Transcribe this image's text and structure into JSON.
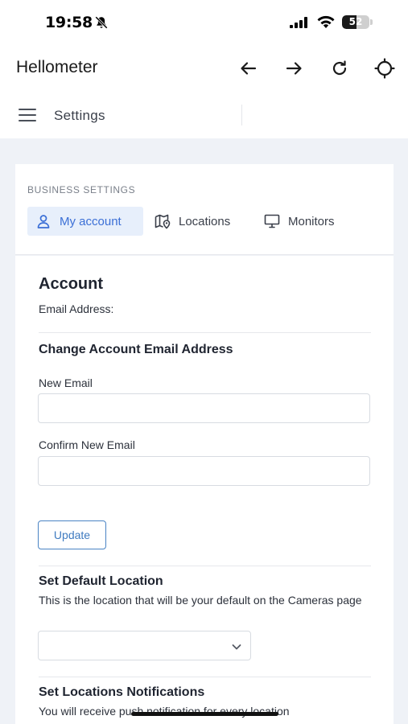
{
  "status_bar": {
    "time": "19:58",
    "battery_percent": "52",
    "battery_level": 52
  },
  "app_bar": {
    "title": "Hellometer",
    "icons": [
      "arrow-left-icon",
      "arrow-right-icon",
      "reload-icon",
      "crosshair-icon"
    ]
  },
  "settings_bar": {
    "title": "Settings",
    "menu_icon": "hamburger-menu-icon"
  },
  "business_settings": {
    "caption": "BUSINESS SETTINGS",
    "tabs": [
      {
        "label": "My account",
        "icon": "user-icon",
        "active": true
      },
      {
        "label": "Locations",
        "icon": "map-pin-icon",
        "active": false
      },
      {
        "label": "Monitors",
        "icon": "monitor-icon",
        "active": false
      }
    ]
  },
  "account": {
    "title": "Account",
    "email_label": "Email Address:",
    "change_email_heading": "Change Account Email Address",
    "new_email_label": "New Email",
    "new_email_value": "",
    "confirm_email_label": "Confirm New Email",
    "confirm_email_value": "",
    "update_label": "Update"
  },
  "default_location": {
    "heading": "Set Default Location",
    "description": "This is the location that will be your default on the Cameras page",
    "selected": ""
  },
  "notifications": {
    "heading": "Set Locations Notifications",
    "description": "You will receive push notification for every location"
  },
  "colors": {
    "accent": "#3b6fd6",
    "active_tab_bg": "#e7effb",
    "update_border": "#4a84c4",
    "page_bg": "#eff2f7"
  }
}
